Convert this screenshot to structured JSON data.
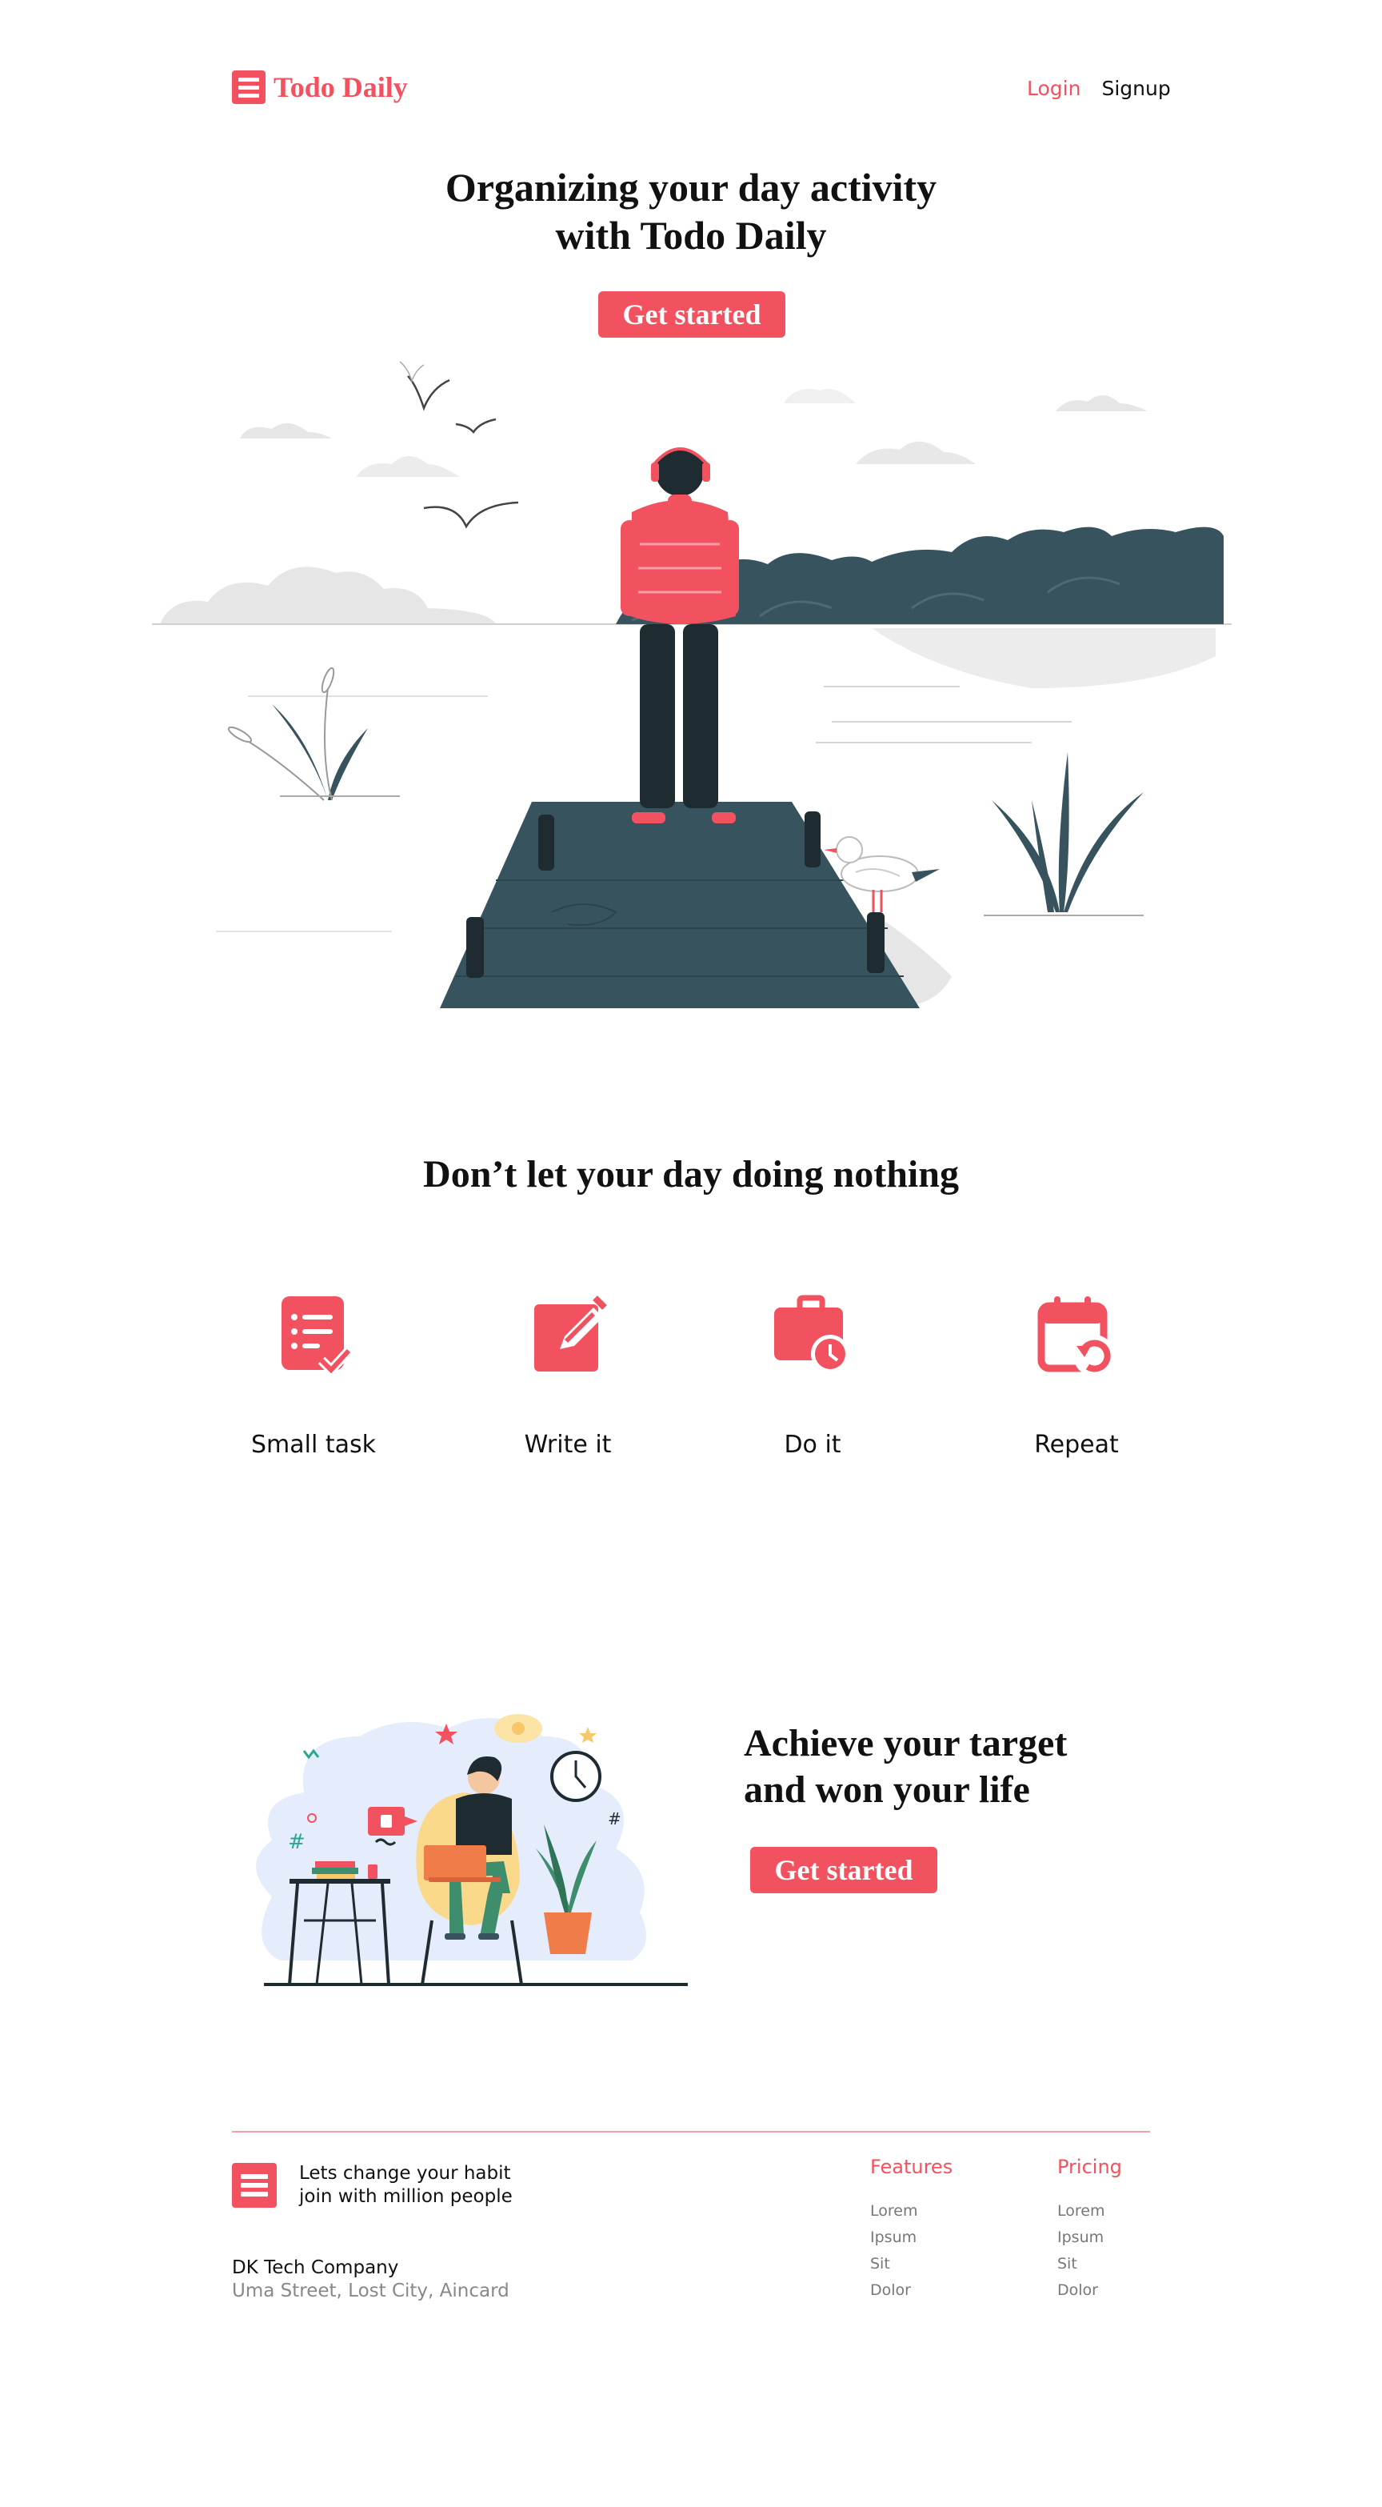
{
  "brand": {
    "name": "Todo Daily"
  },
  "nav": {
    "login": "Login",
    "signup": "Signup"
  },
  "hero": {
    "title_line1": "Organizing your day activity",
    "title_line2": "with Todo Daily",
    "cta": "Get started"
  },
  "features": {
    "heading": "Don’t let your day doing nothing",
    "items": [
      {
        "label": "Small task",
        "icon": "task-list-icon"
      },
      {
        "label": "Write it",
        "icon": "edit-icon"
      },
      {
        "label": "Do it",
        "icon": "briefcase-clock-icon"
      },
      {
        "label": "Repeat",
        "icon": "calendar-repeat-icon"
      }
    ]
  },
  "achieve": {
    "title_line1": "Achieve your target",
    "title_line2": "and won your life",
    "cta": "Get started"
  },
  "footer": {
    "tagline_line1": "Lets change your habit",
    "tagline_line2": "join with million people",
    "company": "DK Tech Company",
    "address": "Uma Street, Lost City, Aincard",
    "columns": [
      {
        "title": "Features",
        "links": [
          "Lorem",
          "Ipsum",
          "Sit",
          "Dolor"
        ]
      },
      {
        "title": "Pricing",
        "links": [
          "Lorem",
          "Ipsum",
          "Sit",
          "Dolor"
        ]
      }
    ]
  },
  "colors": {
    "accent": "#f2525f",
    "dark_teal": "#37535e",
    "light_gray": "#e6e6e6"
  }
}
